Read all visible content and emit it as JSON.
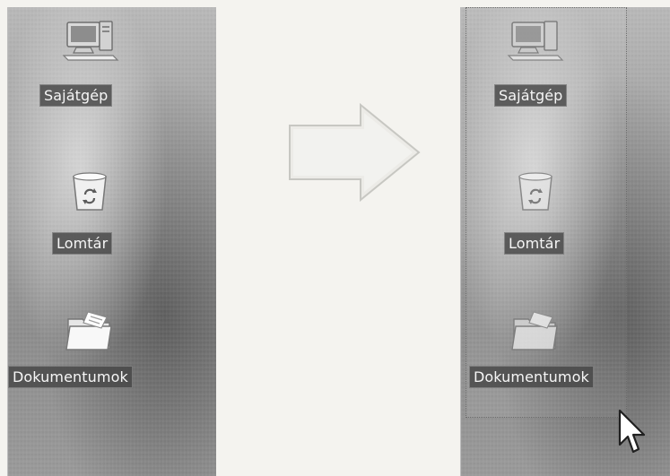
{
  "left_panel": {
    "icons": [
      {
        "label": "Sajátgép",
        "icon": "my-computer-icon"
      },
      {
        "label": "Lomtár",
        "icon": "recycle-bin-icon"
      },
      {
        "label": "Dokumentumok",
        "icon": "documents-folder-icon"
      }
    ]
  },
  "right_panel": {
    "icons": [
      {
        "label": "Sajátgép",
        "icon": "my-computer-icon"
      },
      {
        "label": "Lomtár",
        "icon": "recycle-bin-icon"
      },
      {
        "label": "Dokumentumok",
        "icon": "documents-folder-icon"
      }
    ],
    "selection_active": true
  },
  "arrow_direction": "right",
  "cursor_icon": "mouse-pointer-icon"
}
